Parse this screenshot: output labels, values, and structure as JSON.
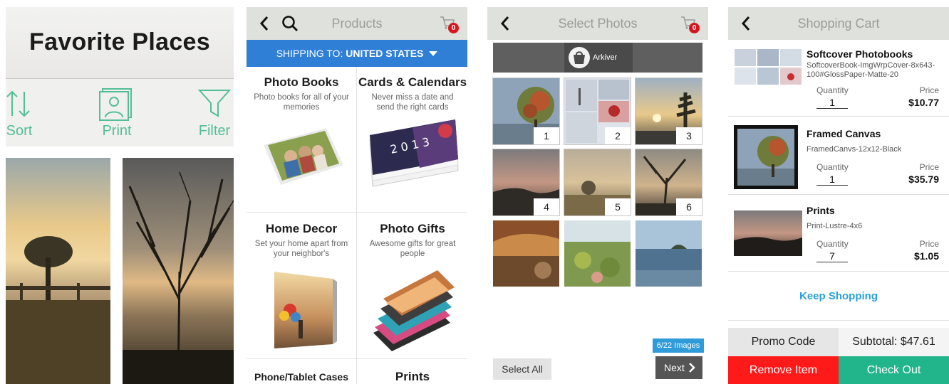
{
  "favorites": {
    "title": "Favorite Places",
    "toolbar": [
      {
        "label": "Sort",
        "icon": "sort-arrows-icon"
      },
      {
        "label": "Print",
        "icon": "print-photos-icon"
      },
      {
        "label": "Filter",
        "icon": "filter-funnel-icon"
      }
    ],
    "accent": "#54bf96"
  },
  "products": {
    "nav_title": "Products",
    "cart_count": "0",
    "shipping_prefix": "SHIPPING TO:",
    "shipping_country": "UNITED STATES",
    "items": [
      {
        "title": "Photo Books",
        "desc": "Photo books for all of your memories"
      },
      {
        "title": "Cards & Calendars",
        "desc": "Never miss a date and send the right cards"
      },
      {
        "title": "Home Decor",
        "desc": "Set your home apart from your neighbor's"
      },
      {
        "title": "Photo Gifts",
        "desc": "Awesome gifts for great people"
      },
      {
        "title": "Phone/Tablet Cases",
        "desc": ""
      },
      {
        "title": "Prints",
        "desc": ""
      }
    ],
    "accent": "#2f7fd6"
  },
  "select_photos": {
    "nav_title": "Select Photos",
    "cart_count": "0",
    "source": "Arkiver",
    "photos": [
      {
        "num": "1"
      },
      {
        "num": "2"
      },
      {
        "num": "3"
      },
      {
        "num": "4"
      },
      {
        "num": "5"
      },
      {
        "num": "6"
      },
      {
        "num": ""
      },
      {
        "num": ""
      },
      {
        "num": ""
      }
    ],
    "count_label": "6/22 Images",
    "select_all": "Select All",
    "next": "Next"
  },
  "cart": {
    "nav_title": "Shopping Cart",
    "items": [
      {
        "name": "Softcover Photobooks",
        "sku": "SoftcoverBook-ImgWrpCover-8x643-100#GlossPaper-Matte-20",
        "qty_label": "Quantity",
        "qty": "1",
        "price_label": "Price",
        "price": "$10.77"
      },
      {
        "name": "Framed Canvas",
        "sku": "FramedCanvs-12x12-Black",
        "qty_label": "Quantity",
        "qty": "1",
        "price_label": "Price",
        "price": "$35.79"
      },
      {
        "name": "Prints",
        "sku": "Print-Lustre-4x6",
        "qty_label": "Quantity",
        "qty": "7",
        "price_label": "Price",
        "price": "$1.05"
      }
    ],
    "keep_shopping": "Keep Shopping",
    "promo": "Promo Code",
    "subtotal": "Subtotal: $47.61",
    "remove": "Remove Item",
    "checkout": "Check Out",
    "colors": {
      "remove": "#ff1a1a",
      "checkout": "#22b58c",
      "link": "#2aa0d8"
    }
  }
}
